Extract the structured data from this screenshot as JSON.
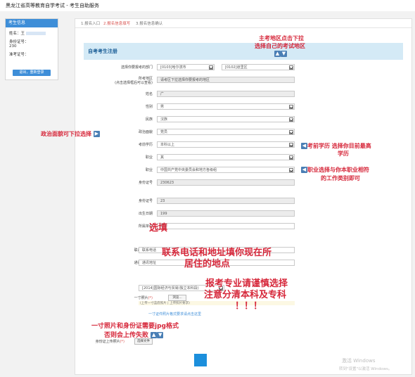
{
  "page": {
    "title": "黑龙江省高等教育自学考试 - 考生自助服务"
  },
  "sidebar": {
    "header": "考生信息",
    "name_label": "姓名：",
    "name_value": "王",
    "idno_label": "身份证号：",
    "idno_value": "230",
    "examno_label": "准考证号：",
    "button": "退出，重新登录"
  },
  "steps": [
    "1.报名入口",
    "2.报名信息填写",
    "3.报名信息确认"
  ],
  "form": {
    "header": "自考考生注册",
    "fields": [
      {
        "label": "选择你要报考的部门",
        "value": "[0103]哈尔滨市",
        "value2": "[0102]道里区"
      },
      {
        "label": "所考地区",
        "label2": "(点击选择框后可以查看)",
        "value": "请考区下拉选择你要报考的地区"
      },
      {
        "label": "姓名",
        "value": "广"
      },
      {
        "label": "性别",
        "value": "男"
      },
      {
        "label": "民族",
        "value": "汉族"
      },
      {
        "label": "政治面貌",
        "value": "党员"
      },
      {
        "label": "考前学历",
        "value": "本科以上"
      },
      {
        "label": "职业",
        "value": "其"
      },
      {
        "label": "职业",
        "value": "中国共产党中央委员会和地方各级组"
      },
      {
        "label": "身份证号",
        "value": "230623"
      },
      {
        "label": "身份证号",
        "value": "23"
      },
      {
        "label": "出生日期",
        "value": "199"
      },
      {
        "label": "所属单位",
        "value": "东华"
      },
      {
        "label": "联系电话",
        "value": "联系电话",
        "required": "(*)"
      },
      {
        "label": "通讯地址",
        "value": "通讯地址",
        "required": "(*)"
      },
      {
        "label": "报考专业",
        "value": "[2014]国际经济与贸易(独立本科段)"
      },
      {
        "label": "一寸照片",
        "required": "(*)",
        "button": "浏览...",
        "note": "(上传一寸蓝底照片 | 上传照片要求)"
      },
      {
        "label": "身份证上传照片",
        "required": "(*)",
        "button": "选择文件"
      }
    ],
    "upload_link": "一寸证件照片格式要求请点击这里"
  },
  "annotations": {
    "region": "主考地区点击下拉",
    "region2": "选择自己的考试地区",
    "politics": "政治面貌可下拉选择",
    "edu": "考前学历 选择你目前最高",
    "edu2": "学历",
    "job": "职业选择与你本职业相符",
    "job2": "的工作类别即可",
    "fill": "选填",
    "contact": "联系电话和地址填你现在所",
    "contact2": "居住的地点",
    "major": "报考专业请谨慎选择",
    "major2": "注意分清本科及专科",
    "major3": "！！！",
    "photo": "一寸照片和身份证需要jpg格式",
    "photo2": "否则会上传失败"
  },
  "watermarks": {
    "a": "激活 Windows",
    "b": "转到\"设置\"以激活 Windows。"
  }
}
